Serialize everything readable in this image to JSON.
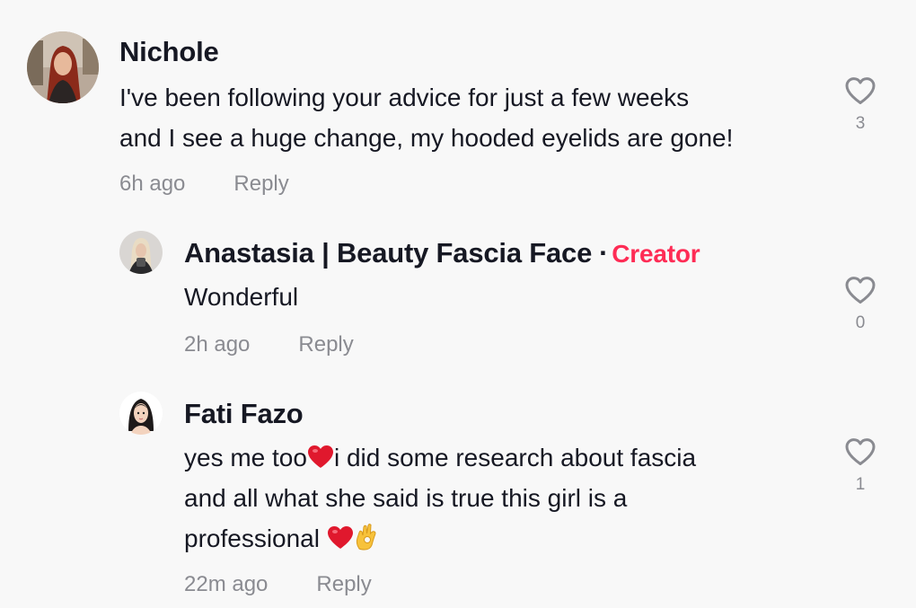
{
  "comments": [
    {
      "username": "Nichole",
      "text_lines": [
        "I've been following your advice for just a few weeks",
        "and I see a huge change, my hooded eyelids are gone!"
      ],
      "time": "6h ago",
      "reply_label": "Reply",
      "likes": "3",
      "avatar_icon": "avatar-photo-red-hair"
    },
    {
      "username": "Anastasia | Beauty Fascia Face",
      "separator": "·",
      "badge": "Creator",
      "text_lines": [
        "Wonderful"
      ],
      "time": "2h ago",
      "reply_label": "Reply",
      "likes": "0",
      "avatar_icon": "avatar-photo-blonde"
    },
    {
      "username": "Fati Fazo",
      "text_lines": [
        "yes me too",
        "i did some research about fascia",
        "and all what she said is true this girl is a",
        "professional "
      ],
      "time": "22m ago",
      "reply_label": "Reply",
      "likes": "1",
      "avatar_icon": "avatar-cartoon-woman"
    }
  ],
  "colors": {
    "background": "#f8f8f8",
    "text": "#161823",
    "muted": "#8a8b91",
    "creator_badge": "#fe2c55",
    "heart_emoji": "#e0182d",
    "ok_emoji": "#f7c23b"
  },
  "icons": {
    "like": "heart-outline-icon",
    "heart_emoji": "red-heart-emoji",
    "ok_emoji": "ok-hand-emoji"
  }
}
